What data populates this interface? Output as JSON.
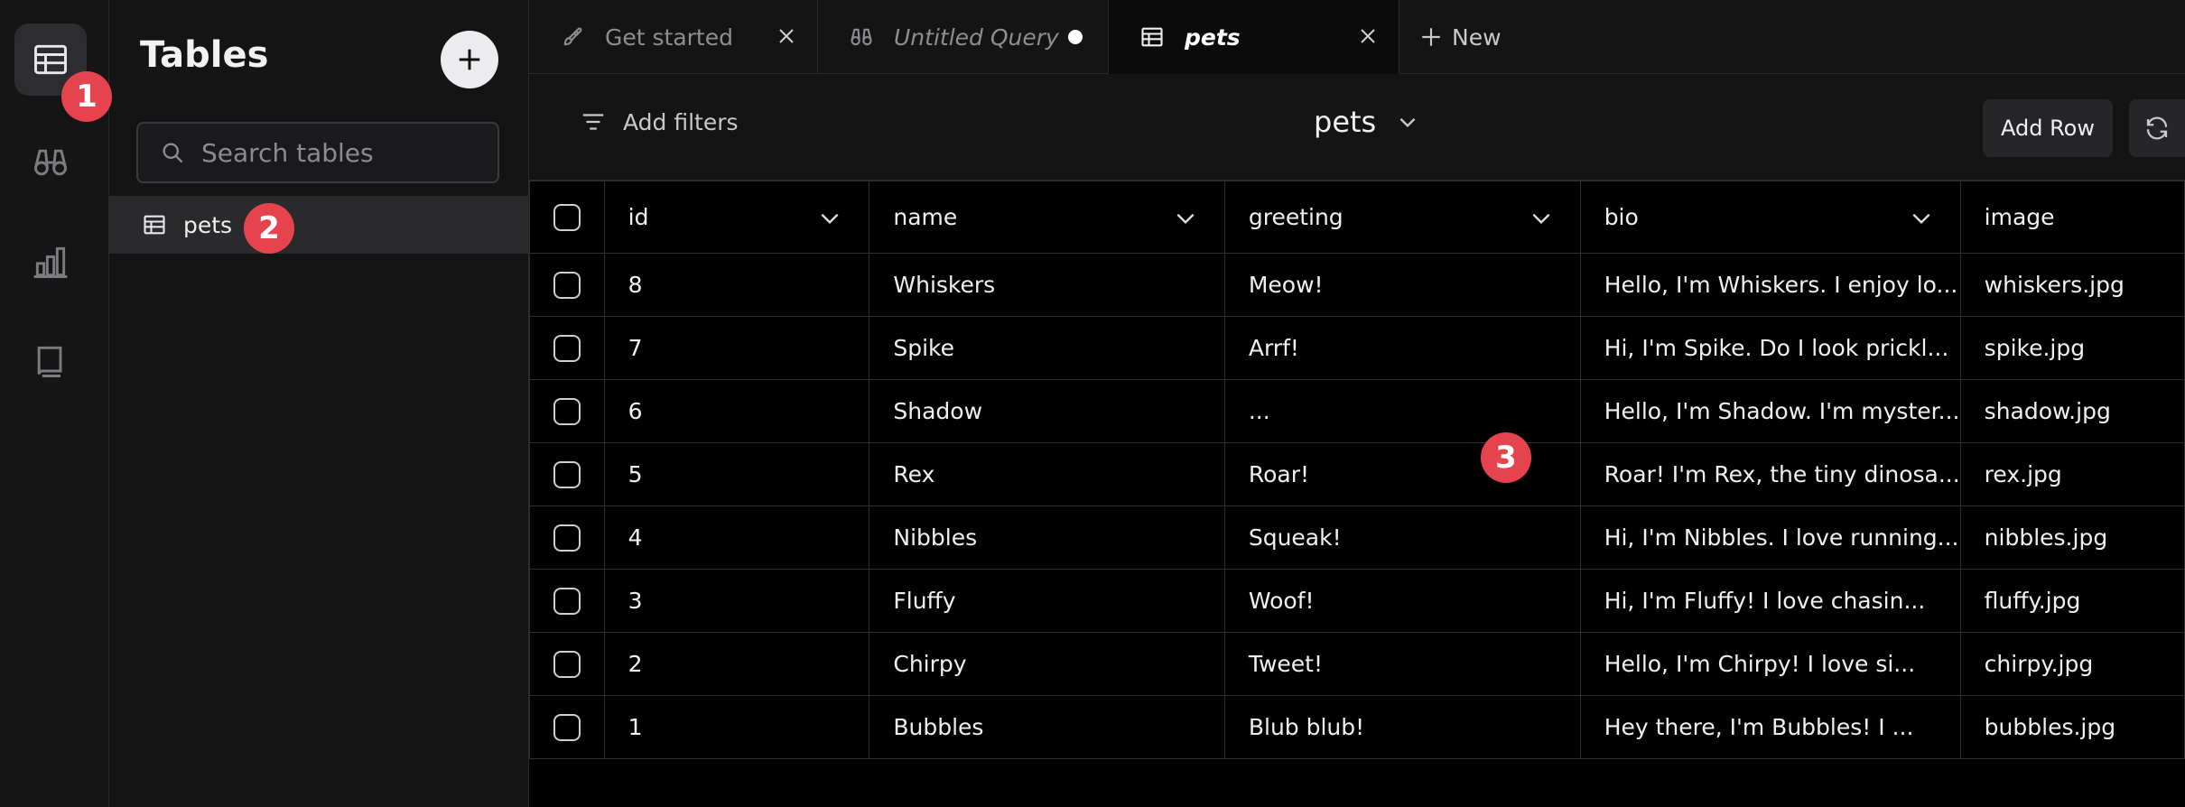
{
  "rail": {
    "items": [
      {
        "name": "tables",
        "icon": "table-icon",
        "active": true
      },
      {
        "name": "queries",
        "icon": "binoculars-icon",
        "active": false
      },
      {
        "name": "charts",
        "icon": "bar-chart-icon",
        "active": false
      },
      {
        "name": "docs",
        "icon": "book-icon",
        "active": false
      }
    ]
  },
  "panel": {
    "title": "Tables",
    "search_placeholder": "Search tables",
    "tables": [
      {
        "label": "pets"
      }
    ]
  },
  "tabs": [
    {
      "label": "Get started",
      "icon": "rocket-icon",
      "status": "close"
    },
    {
      "label": "Untitled Query",
      "icon": "binoculars-icon",
      "status": "unsaved-dot"
    },
    {
      "label": "pets",
      "icon": "table-icon",
      "status": "close",
      "active": true
    }
  ],
  "new_tab_label": "New",
  "toolbar": {
    "filters_label": "Add filters",
    "table_select": "pets",
    "add_row_label": "Add Row"
  },
  "grid": {
    "columns": [
      "id",
      "name",
      "greeting",
      "bio",
      "image"
    ],
    "rows": [
      [
        "8",
        "Whiskers",
        "Meow!",
        "Hello, I'm Whiskers. I enjoy lo...",
        "whiskers.jpg"
      ],
      [
        "7",
        "Spike",
        "Arrf!",
        "Hi, I'm Spike. Do I look prickl...",
        "spike.jpg"
      ],
      [
        "6",
        "Shadow",
        "...",
        "Hello, I'm Shadow. I'm myster...",
        "shadow.jpg"
      ],
      [
        "5",
        "Rex",
        "Roar!",
        "Roar! I'm Rex, the tiny dinosa...",
        "rex.jpg"
      ],
      [
        "4",
        "Nibbles",
        "Squeak!",
        "Hi, I'm Nibbles. I love running...",
        "nibbles.jpg"
      ],
      [
        "3",
        "Fluffy",
        "Woof!",
        "Hi, I'm Fluffy! I love chasin...",
        "fluffy.jpg"
      ],
      [
        "2",
        "Chirpy",
        "Tweet!",
        "Hello, I'm Chirpy! I love si...",
        "chirpy.jpg"
      ],
      [
        "1",
        "Bubbles",
        "Blub blub!",
        "Hey there, I'm Bubbles! I ...",
        "bubbles.jpg"
      ]
    ]
  },
  "markers": [
    "1",
    "2",
    "3"
  ],
  "colors": {
    "marker": "#e5434d",
    "background": "#0f0f10",
    "grid": "#000000"
  }
}
